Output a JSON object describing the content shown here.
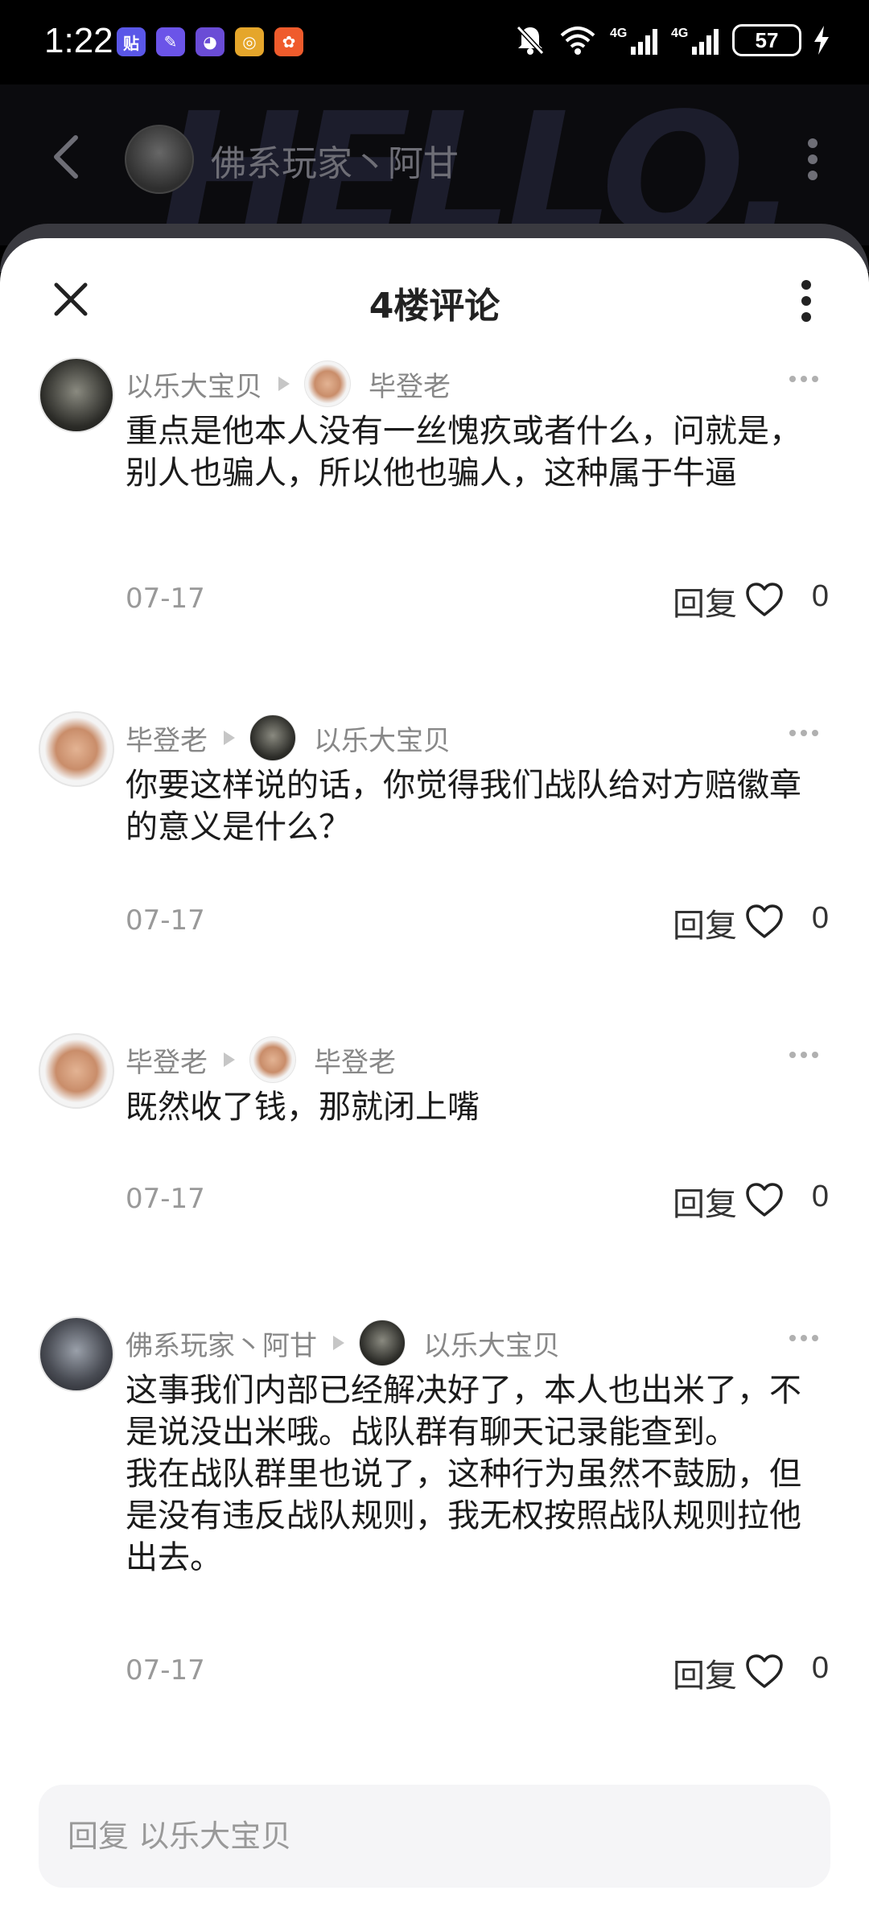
{
  "status_bar": {
    "time": "1:22",
    "app_icons": [
      {
        "name": "tieba",
        "glyph": "贴",
        "color": "#5a57e8"
      },
      {
        "name": "app2",
        "glyph": "✎",
        "color": "#6b54e8"
      },
      {
        "name": "qq",
        "glyph": "◕",
        "color": "#6a4cd6"
      },
      {
        "name": "app4",
        "glyph": "◎",
        "color": "#e5a62b"
      },
      {
        "name": "app5",
        "glyph": "✿",
        "color": "#ef5b2c"
      }
    ],
    "network_labels": [
      "4G",
      "4G"
    ],
    "battery": "57"
  },
  "header": {
    "name": "佛系玩家丶阿甘",
    "bg_text": "HELLO."
  },
  "sheet": {
    "title": "4楼评论"
  },
  "comments": [
    {
      "author": "以乐大宝贝",
      "author_avatar": "dark",
      "reply_to": "毕登老",
      "reply_to_avatar": "man",
      "text": "重点是他本人没有一丝愧疚或者什么，问就是，别人也骗人，所以他也骗人，这种属于牛逼",
      "date": "07-17",
      "reply_label": "回复",
      "likes": "0"
    },
    {
      "author": "毕登老",
      "author_avatar": "man",
      "reply_to": "以乐大宝贝",
      "reply_to_avatar": "dark",
      "text": "你要这样说的话，你觉得我们战队给对方赔徽章的意义是什么？",
      "date": "07-17",
      "reply_label": "回复",
      "likes": "0"
    },
    {
      "author": "毕登老",
      "author_avatar": "man",
      "reply_to": "毕登老",
      "reply_to_avatar": "man",
      "text": "既然收了钱，那就闭上嘴",
      "date": "07-17",
      "reply_label": "回复",
      "likes": "0"
    },
    {
      "author": "佛系玩家丶阿甘",
      "author_avatar": "wolf",
      "reply_to": "以乐大宝贝",
      "reply_to_avatar": "dark",
      "text": "这事我们内部已经解决好了，本人也出米了，不是说没出米哦。战队群有聊天记录能查到。\n我在战队群里也说了，这种行为虽然不鼓励，但是没有违反战队规则，我无权按照战队规则拉他出去。",
      "date": "07-17",
      "reply_label": "回复",
      "likes": "0"
    }
  ],
  "reply_box": {
    "placeholder": "回复 以乐大宝贝"
  }
}
